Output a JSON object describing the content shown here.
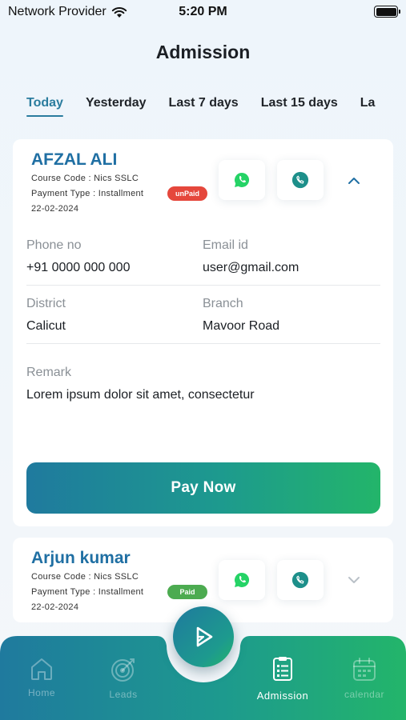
{
  "status_bar": {
    "provider": "Network Provider",
    "time": "5:20 PM"
  },
  "page_title": "Admission",
  "tabs": [
    "Today",
    "Yesterday",
    "Last 7 days",
    "Last 15 days",
    "La"
  ],
  "active_tab": "Today",
  "admissions": [
    {
      "name": "AFZAL ALI",
      "course_code_label": "Course Code   : Nics SSLC",
      "payment_type_label": "Payment Type : Installment",
      "date": "22-02-2024",
      "status": "unPaid",
      "expanded": true,
      "details": {
        "phone_label": "Phone no",
        "phone": "+91 0000 000 000",
        "email_label": "Email id",
        "email": "user@gmail.com",
        "district_label": "District",
        "district": "Calicut",
        "branch_label": "Branch",
        "branch": "Mavoor Road",
        "remark_label": "Remark",
        "remark": "Lorem ipsum dolor sit amet, consectetur"
      },
      "pay_button": "Pay Now"
    },
    {
      "name": "Arjun kumar",
      "course_code_label": "Course Code   : Nics SSLC",
      "payment_type_label": "Payment Type : Installment",
      "date": "22-02-2024",
      "status": "Paid",
      "expanded": false
    }
  ],
  "bottom_nav": [
    {
      "label": "Home",
      "icon": "home-icon",
      "active": false
    },
    {
      "label": "Leads",
      "icon": "target-icon",
      "active": false
    },
    {
      "label": "Admission",
      "icon": "clipboard-list-icon",
      "active": true
    },
    {
      "label": "calendar",
      "icon": "calendar-icon",
      "active": false
    }
  ],
  "fab_icon": "play-logo-icon",
  "colors": {
    "accent_blue": "#1f6fa3",
    "tab_active": "#2a7c9e",
    "gradient_start": "#1f7a9e",
    "gradient_end": "#23b56a",
    "unpaid": "#e5473c",
    "paid": "#4cab50",
    "whatsapp": "#25d366",
    "phone_icon": "#1d8f8a"
  }
}
